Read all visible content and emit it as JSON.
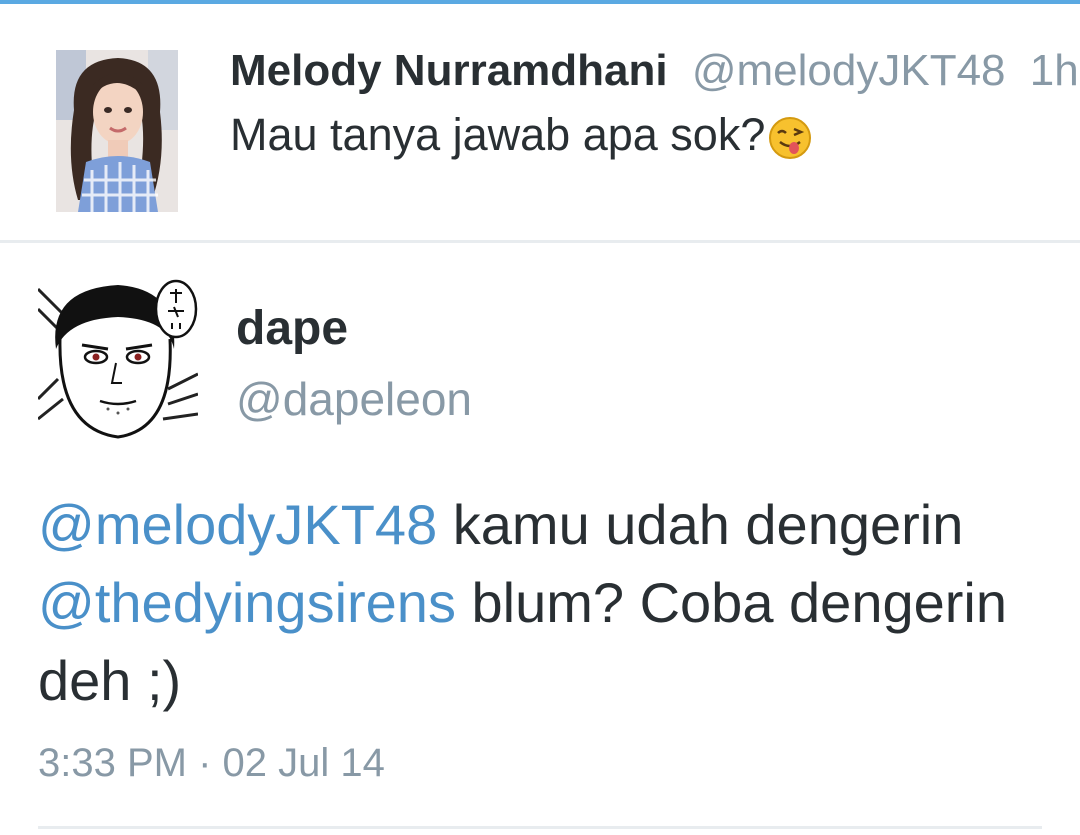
{
  "parent_tweet": {
    "display_name": "Melody Nurramdhani",
    "handle": "@melodyJKT48",
    "time": "1h",
    "text": "Mau tanya jawab apa sok?",
    "emoji": "winking-tongue-face"
  },
  "reply_tweet": {
    "display_name": "dape",
    "handle": "@dapeleon",
    "text_parts": [
      {
        "text": "@melodyJKT48",
        "type": "mention"
      },
      {
        "text": " kamu udah dengerin ",
        "type": "text"
      },
      {
        "text": "@thedyingsirens",
        "type": "mention"
      },
      {
        "text": " blum? Coba dengerin deh ;)",
        "type": "text"
      }
    ],
    "timestamp": "3:33 PM · 02 Jul 14"
  },
  "colors": {
    "accent_bar": "#5aa9e2",
    "mention": "#4a90c9",
    "text": "#292f33",
    "muted": "#8899a6",
    "divider": "#e8ecef"
  }
}
